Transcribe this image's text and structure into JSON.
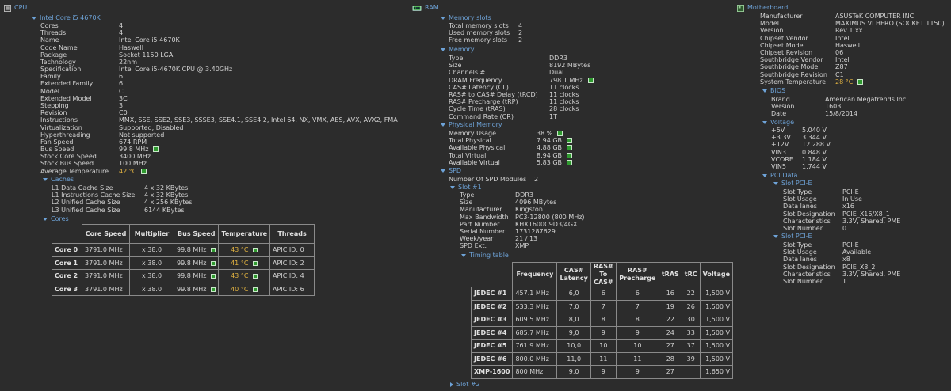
{
  "cpu": {
    "title": "CPU",
    "node": "Intel Core i5 4670K",
    "props": [
      [
        "Cores",
        "4"
      ],
      [
        "Threads",
        "4"
      ],
      [
        "Name",
        "Intel Core i5 4670K"
      ],
      [
        "Code Name",
        "Haswell"
      ],
      [
        "Package",
        "Socket 1150 LGA"
      ],
      [
        "Technology",
        "22nm"
      ],
      [
        "Specification",
        "Intel Core i5-4670K CPU @ 3.40GHz"
      ],
      [
        "Family",
        "6"
      ],
      [
        "Extended Family",
        "6"
      ],
      [
        "Model",
        "C"
      ],
      [
        "Extended Model",
        "3C"
      ],
      [
        "Stepping",
        "3"
      ],
      [
        "Revision",
        "C0"
      ],
      [
        "Instructions",
        "MMX, SSE, SSE2, SSE3, SSSE3, SSE4.1, SSE4.2, Intel 64, NX, VMX, AES, AVX, AVX2, FMA"
      ],
      [
        "Virtualization",
        "Supported, Disabled"
      ],
      [
        "Hyperthreading",
        "Not supported"
      ],
      [
        "Fan Speed",
        "674 RPM"
      ],
      [
        "Bus Speed",
        "99.8 MHz"
      ],
      [
        "Stock Core Speed",
        "3400 MHz"
      ],
      [
        "Stock Bus Speed",
        "100 MHz"
      ],
      [
        "Average Temperature",
        "42 °C"
      ]
    ],
    "caches_label": "Caches",
    "caches": [
      [
        "L1 Data Cache Size",
        "4 x 32 KBytes"
      ],
      [
        "L1 Instructions Cache Size",
        "4 x 32 KBytes"
      ],
      [
        "L2 Unified Cache Size",
        "4 x 256 KBytes"
      ],
      [
        "L3 Unified Cache Size",
        "6144 KBytes"
      ]
    ],
    "cores_label": "Cores",
    "cores_headers": [
      "Core Speed",
      "Multiplier",
      "Bus Speed",
      "Temperature",
      "Threads"
    ],
    "cores": [
      [
        "Core 0",
        "3791.0 MHz",
        "x 38.0",
        "99.8 MHz",
        "43 °C",
        "APIC ID: 0"
      ],
      [
        "Core 1",
        "3791.0 MHz",
        "x 38.0",
        "99.8 MHz",
        "41 °C",
        "APIC ID: 2"
      ],
      [
        "Core 2",
        "3791.0 MHz",
        "x 38.0",
        "99.8 MHz",
        "43 °C",
        "APIC ID: 4"
      ],
      [
        "Core 3",
        "3791.0 MHz",
        "x 38.0",
        "99.8 MHz",
        "40 °C",
        "APIC ID: 6"
      ]
    ]
  },
  "ram": {
    "title": "RAM",
    "slots_label": "Memory slots",
    "slots": [
      [
        "Total memory slots",
        "4"
      ],
      [
        "Used memory slots",
        "2"
      ],
      [
        "Free memory slots",
        "2"
      ]
    ],
    "memory_label": "Memory",
    "memory": [
      [
        "Type",
        "DDR3"
      ],
      [
        "Size",
        "8192 MBytes"
      ],
      [
        "Channels #",
        "Dual"
      ],
      [
        "DRAM Frequency",
        "798.1 MHz"
      ],
      [
        "CAS# Latency (CL)",
        "11 clocks"
      ],
      [
        "RAS# to CAS# Delay (tRCD)",
        "11 clocks"
      ],
      [
        "RAS# Precharge (tRP)",
        "11 clocks"
      ],
      [
        "Cycle Time (tRAS)",
        "28 clocks"
      ],
      [
        "Command Rate (CR)",
        "1T"
      ]
    ],
    "physical_label": "Physical Memory",
    "physical": [
      [
        "Memory Usage",
        "38 %"
      ],
      [
        "Total Physical",
        "7.94 GB"
      ],
      [
        "Available Physical",
        "4.88 GB"
      ],
      [
        "Total Virtual",
        "8.94 GB"
      ],
      [
        "Available Virtual",
        "5.83 GB"
      ]
    ],
    "spd_label": "SPD",
    "spd_modules": [
      "Number Of SPD Modules",
      "2"
    ],
    "slot1_label": "Slot #1",
    "slot1": [
      [
        "Type",
        "DDR3"
      ],
      [
        "Size",
        "4096 MBytes"
      ],
      [
        "Manufacturer",
        "Kingston"
      ],
      [
        "Max Bandwidth",
        "PC3-12800 (800 MHz)"
      ],
      [
        "Part Number",
        "KHX1600C9D3/4GX"
      ],
      [
        "Serial Number",
        "1731287629"
      ],
      [
        "Week/year",
        "21 / 13"
      ],
      [
        "SPD Ext.",
        "XMP"
      ]
    ],
    "timing_label": "Timing table",
    "timing_headers": [
      "Frequency",
      "CAS# Latency",
      "RAS# To CAS#",
      "RAS# Precharge",
      "tRAS",
      "tRC",
      "Voltage"
    ],
    "timing": [
      [
        "JEDEC #1",
        "457.1 MHz",
        "6,0",
        "6",
        "6",
        "16",
        "22",
        "1,500 V"
      ],
      [
        "JEDEC #2",
        "533.3 MHz",
        "7,0",
        "7",
        "7",
        "19",
        "26",
        "1,500 V"
      ],
      [
        "JEDEC #3",
        "609.5 MHz",
        "8,0",
        "8",
        "8",
        "22",
        "30",
        "1,500 V"
      ],
      [
        "JEDEC #4",
        "685.7 MHz",
        "9,0",
        "9",
        "9",
        "24",
        "33",
        "1,500 V"
      ],
      [
        "JEDEC #5",
        "761.9 MHz",
        "10,0",
        "10",
        "10",
        "27",
        "37",
        "1,500 V"
      ],
      [
        "JEDEC #6",
        "800.0 MHz",
        "11,0",
        "11",
        "11",
        "28",
        "39",
        "1,500 V"
      ],
      [
        "XMP-1600",
        "800 MHz",
        "9,0",
        "9",
        "9",
        "27",
        "",
        "1,650 V"
      ]
    ],
    "slot2_label": "Slot #2"
  },
  "mb": {
    "title": "Motherboard",
    "props": [
      [
        "Manufacturer",
        "ASUSTeK COMPUTER INC."
      ],
      [
        "Model",
        "MAXIMUS VI HERO (SOCKET 1150)"
      ],
      [
        "Version",
        "Rev 1.xx"
      ],
      [
        "Chipset Vendor",
        "Intel"
      ],
      [
        "Chipset Model",
        "Haswell"
      ],
      [
        "Chipset Revision",
        "06"
      ],
      [
        "Southbridge Vendor",
        "Intel"
      ],
      [
        "Southbridge Model",
        "Z87"
      ],
      [
        "Southbridge Revision",
        "C1"
      ],
      [
        "System Temperature",
        "28 °C"
      ]
    ],
    "bios_label": "BIOS",
    "bios": [
      [
        "Brand",
        "American Megatrends Inc."
      ],
      [
        "Version",
        "1603"
      ],
      [
        "Date",
        "15/8/2014"
      ]
    ],
    "voltage_label": "Voltage",
    "voltage": [
      [
        "+5V",
        "5.040 V"
      ],
      [
        "+3.3V",
        "3.344 V"
      ],
      [
        "+12V",
        "12.288 V"
      ],
      [
        "VIN3",
        "0.848 V"
      ],
      [
        "VCORE",
        "1.184 V"
      ],
      [
        "VIN5",
        "1.744 V"
      ]
    ],
    "pci_label": "PCI Data",
    "slot_pcie_label": "Slot PCI-E",
    "pci1": [
      [
        "Slot Type",
        "PCI-E"
      ],
      [
        "Slot Usage",
        "In Use"
      ],
      [
        "Data lanes",
        "x16"
      ],
      [
        "Slot Designation",
        "PCIE_X16/X8_1"
      ],
      [
        "Characteristics",
        "3.3V, Shared, PME"
      ],
      [
        "Slot Number",
        "0"
      ]
    ],
    "pci2": [
      [
        "Slot Type",
        "PCI-E"
      ],
      [
        "Slot Usage",
        "Available"
      ],
      [
        "Data lanes",
        "x8"
      ],
      [
        "Slot Designation",
        "PCIE_X8_2"
      ],
      [
        "Characteristics",
        "3.3V, Shared, PME"
      ],
      [
        "Slot Number",
        "1"
      ]
    ]
  },
  "colors": {
    "accent": "#6ea3d8",
    "temp": "#e2b341",
    "indicator": "#2f9a2f",
    "bg": "#2c2c2c"
  }
}
